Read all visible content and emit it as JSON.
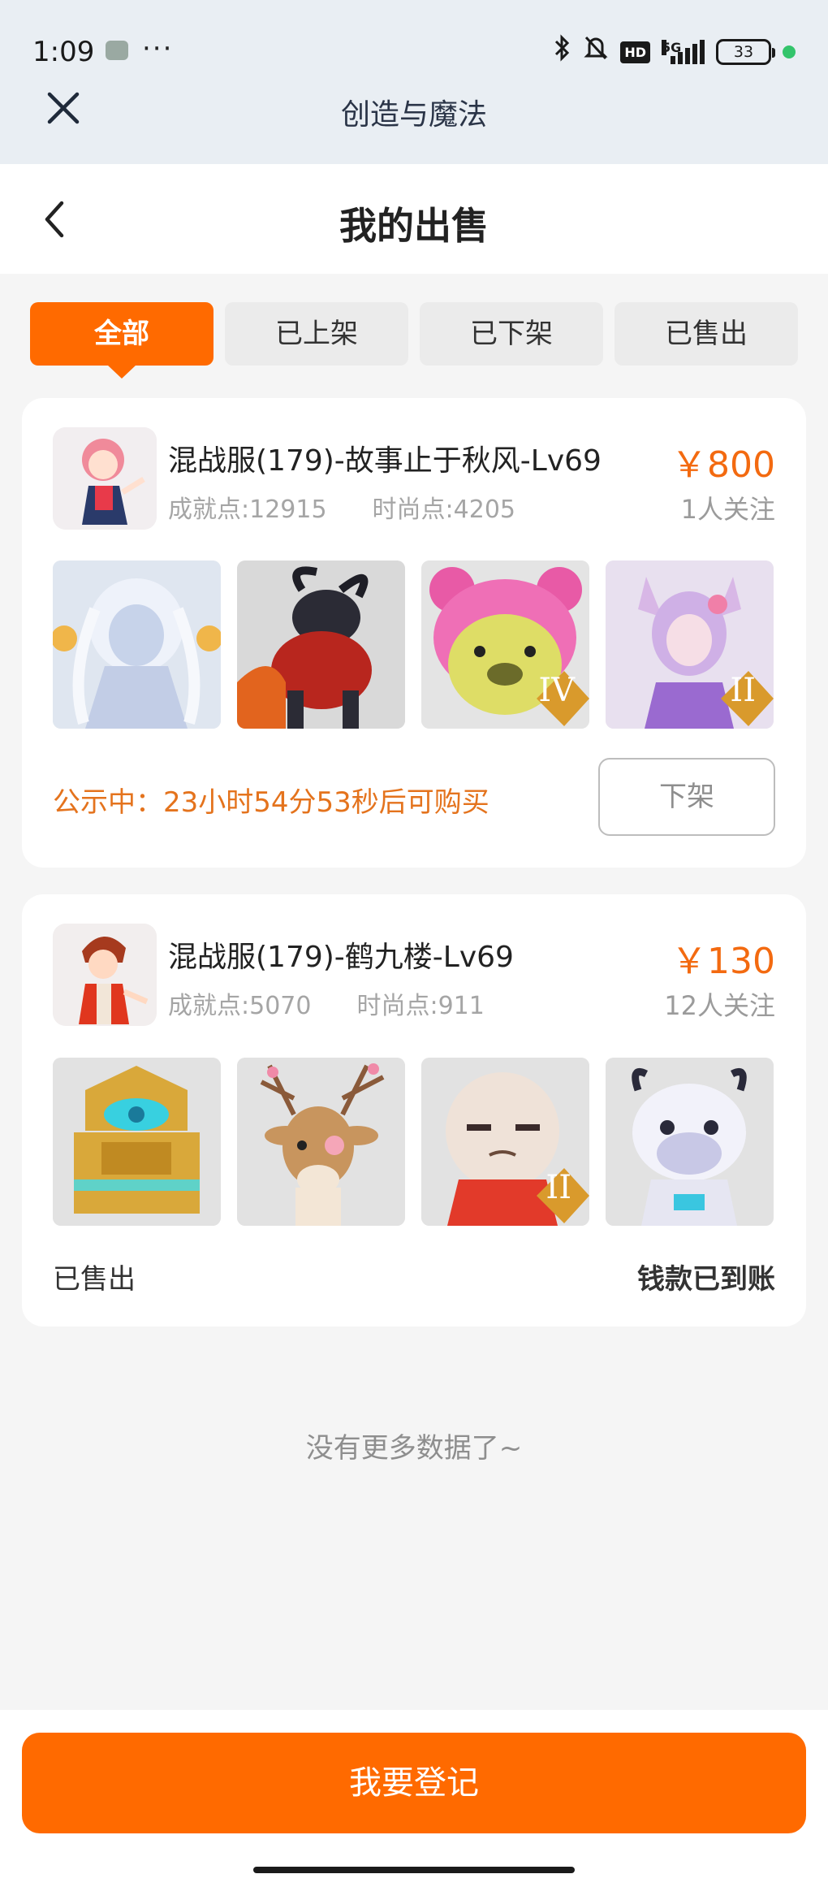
{
  "status_bar": {
    "time": "1:09",
    "dots": "···",
    "network": "5G",
    "hd": "HD",
    "battery": "33"
  },
  "app_bar": {
    "title": "创造与魔法"
  },
  "page": {
    "title": "我的出售"
  },
  "tabs": [
    {
      "label": "全部",
      "active": true
    },
    {
      "label": "已上架",
      "active": false
    },
    {
      "label": "已下架",
      "active": false
    },
    {
      "label": "已售出",
      "active": false
    }
  ],
  "listings": [
    {
      "name": "混战服(179)-故事止于秋风-Lv69",
      "achievement": "成就点:12915",
      "fashion": "时尚点:4205",
      "price": "￥800",
      "followers": "1人关注",
      "notice": "公示中：23小时54分53秒后可购买",
      "action_button": "下架",
      "thumbs": [
        "white-spirit-character",
        "dark-beast-mount",
        "pink-bear-costume",
        "fox-girl-character"
      ],
      "thumb_badges": [
        "",
        "",
        "IV",
        "II"
      ]
    },
    {
      "name": "混战服(179)-鹤九楼-Lv69",
      "achievement": "成就点:5070",
      "fashion": "时尚点:911",
      "price": "￥130",
      "followers": "12人关注",
      "status_left": "已售出",
      "status_right": "钱款已到账",
      "thumbs": [
        "golden-throne",
        "sika-deer",
        "bun-head-character",
        "astronaut-cow"
      ],
      "thumb_badges": [
        "",
        "",
        "II",
        ""
      ]
    }
  ],
  "footer": {
    "no_more": "没有更多数据了~",
    "register_button": "我要登记"
  },
  "colors": {
    "accent": "#ff6a00",
    "price": "#f36a10",
    "notice": "#e4731d"
  }
}
